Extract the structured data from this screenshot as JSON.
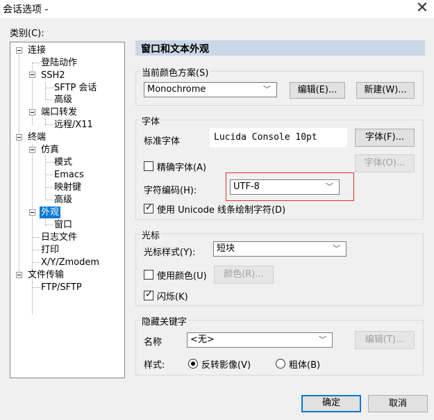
{
  "window": {
    "title": "会话选项 -"
  },
  "category_label": "类别(C):",
  "tree": [
    "连接",
    "登陆动作",
    "SSH2",
    "SFTP 会话",
    "高级",
    "端口转发",
    "远程/X11",
    "终端",
    "仿真",
    "模式",
    "Emacs",
    "映射键",
    "高级",
    "外观",
    "窗口",
    "日志文件",
    "打印",
    "X/Y/Zmodem",
    "文件传输",
    "FTP/SFTP"
  ],
  "section_title": "窗口和文本外观",
  "color_scheme": {
    "label": "当前颜色方案(S)",
    "value": "Monochrome",
    "edit_button": "编辑(E)...",
    "new_button": "新建(W)..."
  },
  "font": {
    "group_label": "字体",
    "standard_label": "标准字体",
    "standard_value": "Lucida Console 10pt",
    "font_button": "字体(F)...",
    "precise_label": "精确字体(A)",
    "precise_checked": false,
    "precise_button": "字体(O)...",
    "encoding_label": "字符编码(H):",
    "encoding_value": "UTF-8",
    "unicode_label": "使用 Unicode 线条绘制字符(D)",
    "unicode_checked": true
  },
  "cursor": {
    "group_label": "光标",
    "style_label": "光标样式(Y):",
    "style_value": "短块",
    "use_color_label": "使用颜色(U)",
    "use_color_checked": false,
    "color_button": "颜色(R)...",
    "blink_label": "闪烁(K)",
    "blink_checked": true
  },
  "hidden_keyword": {
    "group_label": "隐藏关键字",
    "name_label": "名称",
    "name_value": "<无>",
    "edit_button": "编辑(T)...",
    "style_label": "样式:",
    "reverse_label": "反转影像(V)",
    "reverse_selected": true,
    "bold_label": "粗体(B)"
  },
  "footer": {
    "ok_button": "确定",
    "cancel_button": "取消"
  }
}
